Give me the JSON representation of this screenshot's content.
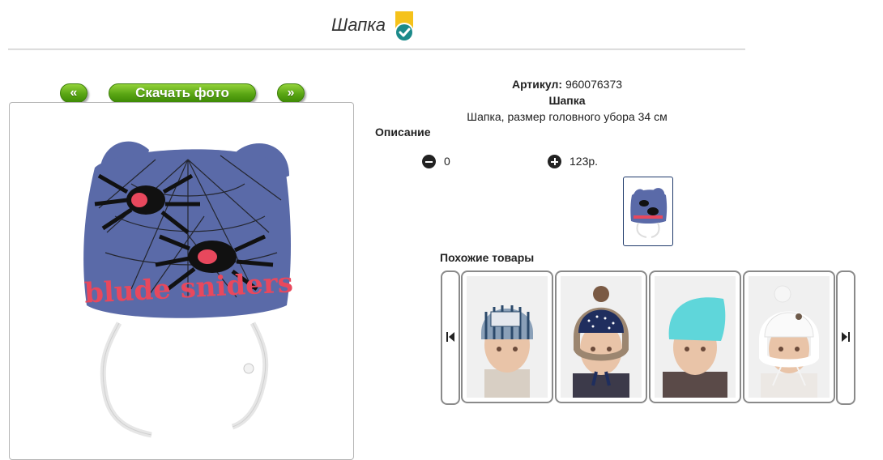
{
  "header": {
    "title": "Шапка"
  },
  "gallery": {
    "prev_label": "«",
    "download_label": "Скачать фото",
    "next_label": "»",
    "hat_print_text": "blude sniders"
  },
  "product": {
    "article_label": "Артикул:",
    "article_value": "960076373",
    "name": "Шапка",
    "size_text": "Шапка, размер головного убора 34 см",
    "description_heading": "Описание",
    "quantity": "0",
    "price": "123р."
  },
  "similar": {
    "heading": "Похожие товары"
  },
  "colors": {
    "accent_green": "#5aa614",
    "badge_yellow": "#f5c21b",
    "badge_teal": "#1c8a8a",
    "hat_blue": "#5a6aa8",
    "thumb_border": "#1f3a6b"
  },
  "icons": [
    "verified-badge-icon",
    "minus-circle-icon",
    "plus-circle-icon",
    "arrow-left-icon",
    "arrow-right-icon"
  ]
}
